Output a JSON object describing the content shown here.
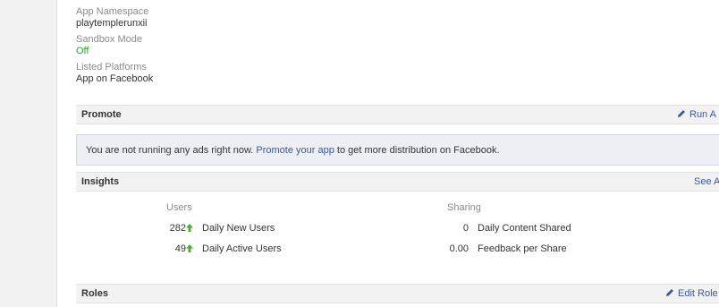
{
  "app_info": {
    "namespace_label": "App Namespace",
    "namespace_value": "playtemplerunxii",
    "sandbox_label": "Sandbox Mode",
    "sandbox_value": "Off",
    "platforms_label": "Listed Platforms",
    "platforms_value": "App on Facebook"
  },
  "promote": {
    "title": "Promote",
    "action": "Run A",
    "message_prefix": "You are not running any ads right now.",
    "link": "Promote your app",
    "message_suffix": "to get more distribution on Facebook."
  },
  "insights": {
    "title": "Insights",
    "action": "See A",
    "users_header": "Users",
    "sharing_header": "Sharing",
    "users": [
      {
        "value": "282",
        "label": "Daily New Users",
        "trend": "up"
      },
      {
        "value": "49",
        "label": "Daily Active Users",
        "trend": "up"
      }
    ],
    "sharing": [
      {
        "value": "0",
        "label": "Daily Content Shared"
      },
      {
        "value": "0.00",
        "label": "Feedback per Share"
      }
    ]
  },
  "roles": {
    "title": "Roles",
    "action": "Edit Role"
  },
  "colors": {
    "link": "#3b5998",
    "off_status": "#2ba32b",
    "up_arrow": "#4caf30",
    "section_bg": "#f2f2f2",
    "notice_bg": "#edeff4"
  }
}
